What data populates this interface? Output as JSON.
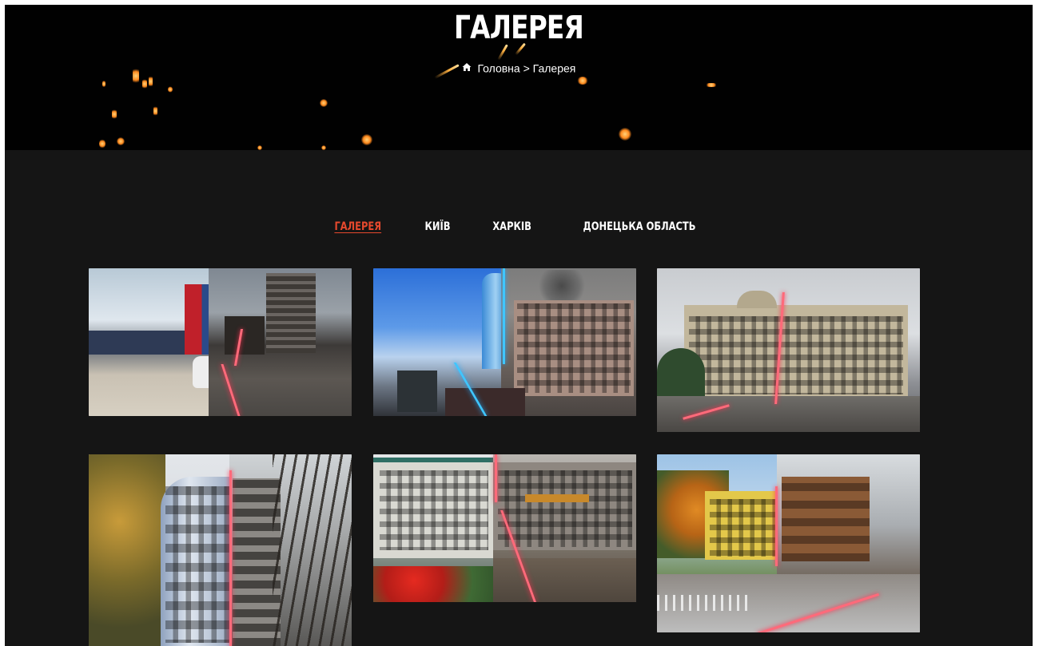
{
  "hero": {
    "title": "ГАЛЕРЕЯ",
    "breadcrumb": {
      "home_icon": "home-icon",
      "home": "Головна",
      "separator": ">",
      "current": "Галерея"
    }
  },
  "tabs": [
    {
      "label": "ГАЛЕРЕЯ",
      "active": true
    },
    {
      "label": "КИЇВ",
      "active": false
    },
    {
      "label": "ХАРКІВ",
      "active": false
    },
    {
      "label": "ДОНЕЦЬКА ОБЛАСТЬ",
      "active": false
    }
  ],
  "gallery": [
    {
      "name": "gallery-image-1"
    },
    {
      "name": "gallery-image-2"
    },
    {
      "name": "gallery-image-3"
    },
    {
      "name": "gallery-image-4"
    },
    {
      "name": "gallery-image-5"
    },
    {
      "name": "gallery-image-6"
    }
  ],
  "colors": {
    "background": "#151515",
    "hero": "#010101",
    "accent": "#e6492d",
    "seam": "#ff6a7a"
  }
}
